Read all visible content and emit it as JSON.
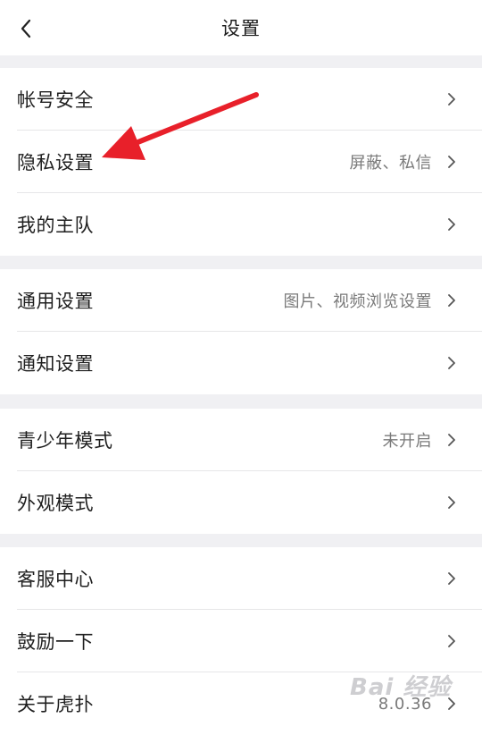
{
  "header": {
    "title": "设置"
  },
  "groups": [
    {
      "rows": [
        {
          "label": "帐号安全",
          "value": ""
        },
        {
          "label": "隐私设置",
          "value": "屏蔽、私信"
        },
        {
          "label": "我的主队",
          "value": ""
        }
      ]
    },
    {
      "rows": [
        {
          "label": "通用设置",
          "value": "图片、视频浏览设置"
        },
        {
          "label": "通知设置",
          "value": ""
        }
      ]
    },
    {
      "rows": [
        {
          "label": "青少年模式",
          "value": "未开启"
        },
        {
          "label": "外观模式",
          "value": ""
        }
      ]
    },
    {
      "rows": [
        {
          "label": "客服中心",
          "value": ""
        },
        {
          "label": "鼓励一下",
          "value": ""
        },
        {
          "label": "关于虎扑",
          "value": "8.0.36"
        }
      ]
    }
  ],
  "watermark": {
    "text": "Bai 经验"
  },
  "colors": {
    "annotation_arrow": "#e8202a",
    "background": "#f0f0f3"
  }
}
